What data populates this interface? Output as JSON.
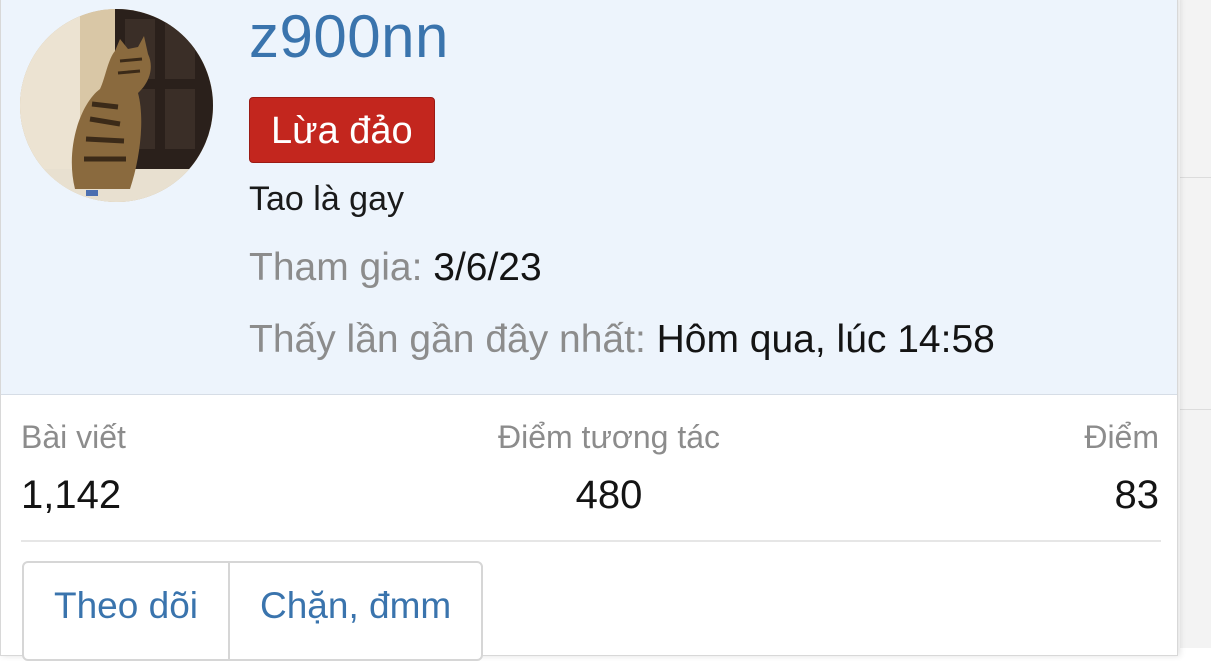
{
  "user": {
    "username": "z900nn",
    "avatar_icon": "cat-avatar",
    "badge": "Lừa đảo",
    "custom_title": "Tao là gay",
    "joined_label": "Tham gia:",
    "joined_value": "3/6/23",
    "last_seen_label": "Thấy lần gần đây nhất:",
    "last_seen_value": "Hôm qua, lúc 14:58"
  },
  "stats": [
    {
      "label": "Bài viết",
      "value": "1,142"
    },
    {
      "label": "Điểm tương tác",
      "value": "480"
    },
    {
      "label": "Điểm",
      "value": "83"
    }
  ],
  "actions": {
    "follow": "Theo dõi",
    "ignore": "Chặn, đmm"
  },
  "colors": {
    "accent": "#3a74ad",
    "header_bg": "#edf4fc",
    "badge_bg": "#c3261e",
    "muted_text": "#8c8c8c"
  }
}
